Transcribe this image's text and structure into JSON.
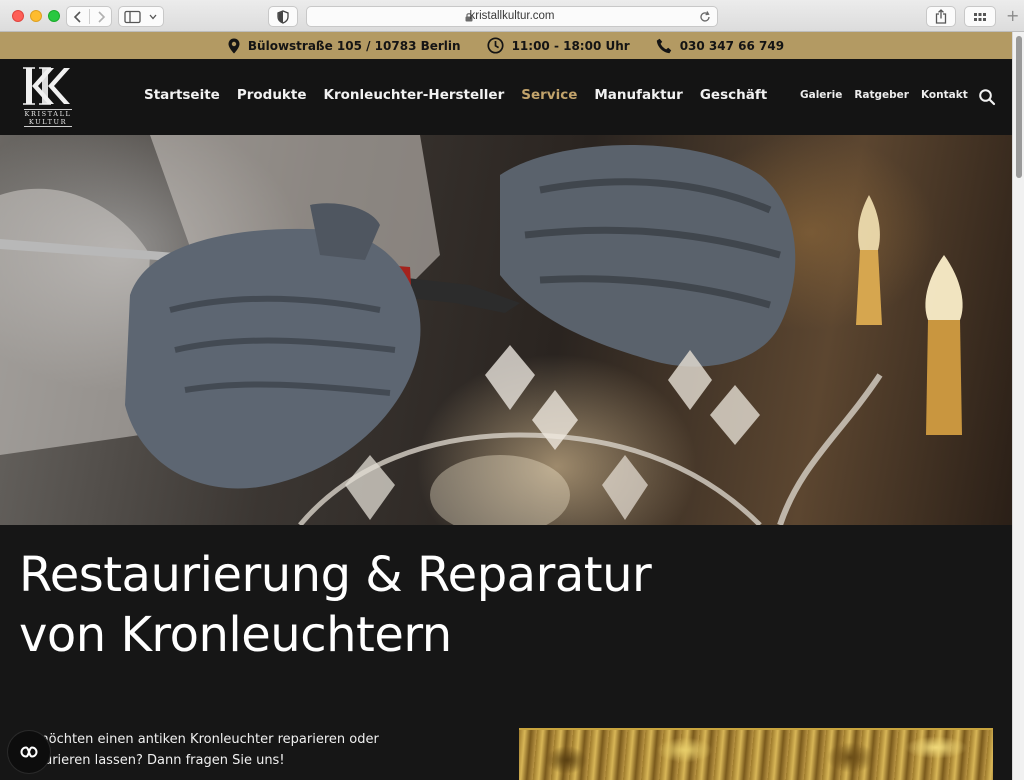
{
  "browser": {
    "url": "kristallkultur.com"
  },
  "infobar": {
    "address": "Bülowstraße 105 / 10783 Berlin",
    "hours": "11:00 - 18:00 Uhr",
    "phone": "030 347 66 749"
  },
  "logo": {
    "line1": "KRISTALL",
    "line2": "KULTUR"
  },
  "main_nav": [
    {
      "label": "Startseite",
      "active": false
    },
    {
      "label": "Produkte",
      "active": false
    },
    {
      "label": "Kronleuchter-Hersteller",
      "active": false
    },
    {
      "label": "Service",
      "active": true
    },
    {
      "label": "Manufaktur",
      "active": false
    },
    {
      "label": "Geschäft",
      "active": false
    }
  ],
  "secondary_nav": [
    "Galerie",
    "Ratgeber",
    "Kontakt"
  ],
  "content": {
    "headline_line1": "Restaurierung & Reparatur",
    "headline_line2": "von Kronleuchtern",
    "intro_line1": "möchten einen antiken Kronleuchter reparieren oder",
    "intro_line2": "aurieren lassen? Dann fragen Sie uns!"
  },
  "colors": {
    "accent_gold": "#b39a63",
    "nav_active": "#c2a36b",
    "page_background": "#161616"
  }
}
